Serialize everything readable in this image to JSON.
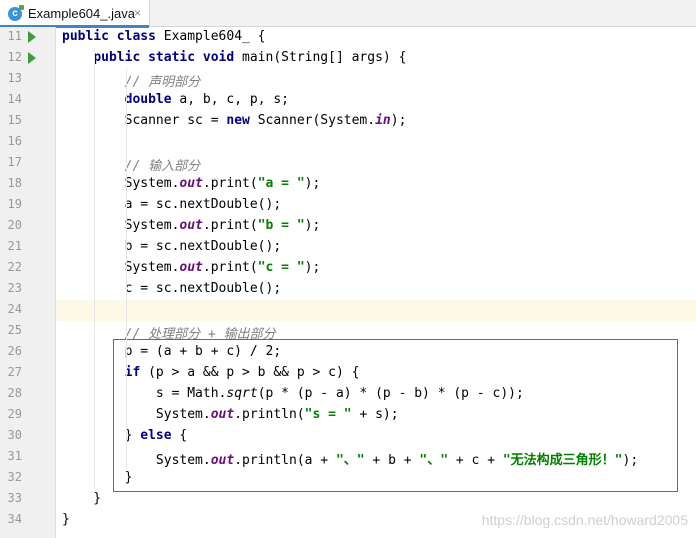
{
  "tab": {
    "filename": "Example604_.java",
    "icon": "java-class-icon",
    "icon_letter": "c",
    "close": "×"
  },
  "watermark": "https://blog.csdn.net/howard2005",
  "colors": {
    "keyword": "#000080",
    "string": "#008000",
    "comment": "#808080",
    "field": "#660e7a",
    "highlight_border": "#d63c3c",
    "current_line": "#fcfae7"
  },
  "lines": [
    {
      "n": "11",
      "run": true,
      "tokens": [
        [
          "kw",
          "public class "
        ],
        [
          "",
          "Example604_ {"
        ]
      ]
    },
    {
      "n": "12",
      "run": true,
      "tokens": [
        [
          "",
          "    "
        ],
        [
          "kw",
          "public static void "
        ],
        [
          "",
          "main(String[] args) {"
        ]
      ]
    },
    {
      "n": "13",
      "tokens": [
        [
          "",
          "        "
        ],
        [
          "cmt",
          "// 声明部分"
        ]
      ]
    },
    {
      "n": "14",
      "tokens": [
        [
          "",
          "        "
        ],
        [
          "kw",
          "double "
        ],
        [
          "",
          "a, b, c, p, s;"
        ]
      ]
    },
    {
      "n": "15",
      "tokens": [
        [
          "",
          "        Scanner sc = "
        ],
        [
          "kw",
          "new "
        ],
        [
          "",
          "Scanner(System."
        ],
        [
          "fld",
          "in"
        ],
        [
          "",
          ");"
        ]
      ]
    },
    {
      "n": "16",
      "tokens": []
    },
    {
      "n": "17",
      "tokens": [
        [
          "",
          "        "
        ],
        [
          "cmt",
          "// 输入部分"
        ]
      ]
    },
    {
      "n": "18",
      "tokens": [
        [
          "",
          "        System."
        ],
        [
          "fld",
          "out"
        ],
        [
          "",
          ".print("
        ],
        [
          "str",
          "\"a = \""
        ],
        [
          "",
          ");"
        ]
      ]
    },
    {
      "n": "19",
      "tokens": [
        [
          "",
          "        a = sc.nextDouble();"
        ]
      ]
    },
    {
      "n": "20",
      "tokens": [
        [
          "",
          "        System."
        ],
        [
          "fld",
          "out"
        ],
        [
          "",
          ".print("
        ],
        [
          "str",
          "\"b = \""
        ],
        [
          "",
          ");"
        ]
      ]
    },
    {
      "n": "21",
      "tokens": [
        [
          "",
          "        b = sc.nextDouble();"
        ]
      ]
    },
    {
      "n": "22",
      "tokens": [
        [
          "",
          "        System."
        ],
        [
          "fld",
          "out"
        ],
        [
          "",
          ".print("
        ],
        [
          "str",
          "\"c = \""
        ],
        [
          "",
          ");"
        ]
      ]
    },
    {
      "n": "23",
      "tokens": [
        [
          "",
          "        c = sc.nextDouble();"
        ]
      ]
    },
    {
      "n": "24",
      "current": true,
      "tokens": []
    },
    {
      "n": "25",
      "tokens": [
        [
          "",
          "        "
        ],
        [
          "cmt",
          "// 处理部分 + 输出部分"
        ]
      ]
    },
    {
      "n": "26",
      "tokens": [
        [
          "",
          "        p = (a + b + c) / 2;"
        ]
      ]
    },
    {
      "n": "27",
      "tokens": [
        [
          "",
          "        "
        ],
        [
          "kw",
          "if "
        ],
        [
          "",
          "(p > a && p > b && p > c) {"
        ]
      ]
    },
    {
      "n": "28",
      "tokens": [
        [
          "",
          "            s = Math."
        ],
        [
          "mth",
          "sqrt"
        ],
        [
          "",
          "(p * (p - a) * (p - b) * (p - c));"
        ]
      ]
    },
    {
      "n": "29",
      "tokens": [
        [
          "",
          "            System."
        ],
        [
          "fld",
          "out"
        ],
        [
          "",
          ".println("
        ],
        [
          "str",
          "\"s = \""
        ],
        [
          "",
          " + s);"
        ]
      ]
    },
    {
      "n": "30",
      "tokens": [
        [
          "",
          "        } "
        ],
        [
          "kw",
          "else "
        ],
        [
          "",
          "{"
        ]
      ]
    },
    {
      "n": "31",
      "tokens": [
        [
          "",
          "            System."
        ],
        [
          "fld",
          "out"
        ],
        [
          "",
          ".println(a + "
        ],
        [
          "str",
          "\"、\""
        ],
        [
          "",
          " + b + "
        ],
        [
          "str",
          "\"、\""
        ],
        [
          "",
          " + c + "
        ],
        [
          "str",
          "\"无法构成三角形！\""
        ],
        [
          "",
          ");"
        ]
      ]
    },
    {
      "n": "32",
      "tokens": [
        [
          "",
          "        }"
        ]
      ]
    },
    {
      "n": "33",
      "tokens": [
        [
          "",
          "    }"
        ]
      ]
    },
    {
      "n": "34",
      "tokens": [
        [
          "",
          "}"
        ]
      ]
    }
  ]
}
